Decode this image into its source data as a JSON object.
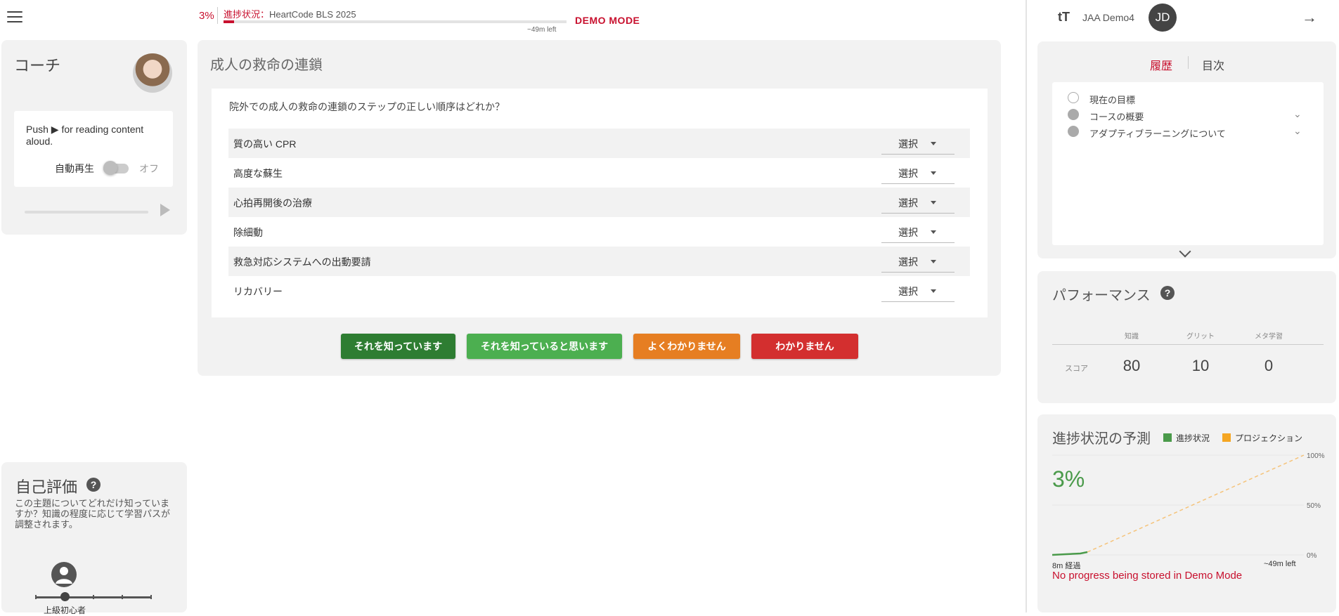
{
  "header": {
    "progress_percent_text": "3%",
    "progress_fraction": 0.03,
    "progress_label_prefix": "進捗状況：",
    "progress_label_course": "HeartCode BLS 2025",
    "time_left": "~49m left",
    "demo_mode": "DEMO MODE"
  },
  "coach": {
    "title": "コーチ",
    "read_aloud_text": "Push ▶ for reading content aloud.",
    "autoplay_label": "自動再生",
    "autoplay_state": "オフ"
  },
  "self_eval": {
    "title": "自己評価",
    "help_icon": "?",
    "description": "この主題についてどれだけ知っていますか？知識の程度に応じて学習パスが調整されます。",
    "level_label": "上級初心者",
    "level_fraction": 0.25
  },
  "main": {
    "title": "成人の救命の連鎖",
    "question": "院外での成人の救命の連鎖のステップの正しい順序はどれか？",
    "select_placeholder": "選択",
    "items": [
      {
        "label": "質の高い CPR"
      },
      {
        "label": "高度な蘇生"
      },
      {
        "label": "心拍再開後の治療"
      },
      {
        "label": "除細動"
      },
      {
        "label": "救急対応システムへの出動要請"
      },
      {
        "label": "リカバリー"
      }
    ],
    "buttons": {
      "know": "それを知っています",
      "think_know": "それを知っていると思います",
      "unsure": "よくわかりません",
      "dont_know": "わかりません"
    }
  },
  "user": {
    "textsize_icon": "tT",
    "name": "JAA Demo4",
    "initials": "JD",
    "exit_icon": "→"
  },
  "history": {
    "tab_history": "履歴",
    "tab_toc": "目次",
    "items": [
      {
        "label": "現在の目標"
      },
      {
        "label": "コースの概要"
      },
      {
        "label": "アダプティブラーニングについて"
      }
    ]
  },
  "performance": {
    "title": "パフォーマンス",
    "help_icon": "?",
    "columns": [
      "知識",
      "グリット",
      "メタ学習"
    ],
    "row_label": "スコア",
    "values": [
      "80",
      "10",
      "0"
    ]
  },
  "projection": {
    "title": "進捗状況の予測",
    "legend_progress": "進捗状況",
    "legend_projection": "プロジェクション",
    "percent_text": "3%",
    "ticks": [
      "100%",
      "50%",
      "0%"
    ],
    "elapsed": "8m 経過",
    "time_left": "~49m left",
    "demo_notice": "No progress being stored in Demo Mode",
    "colors": {
      "progress": "#4a9a4a",
      "projection": "#f5a623"
    }
  },
  "colors": {
    "accent_red": "#c8102e",
    "btn_know": "#2e7d32",
    "btn_think": "#4caf50",
    "btn_unsure": "#e67e22",
    "btn_dont": "#d32f2f"
  }
}
